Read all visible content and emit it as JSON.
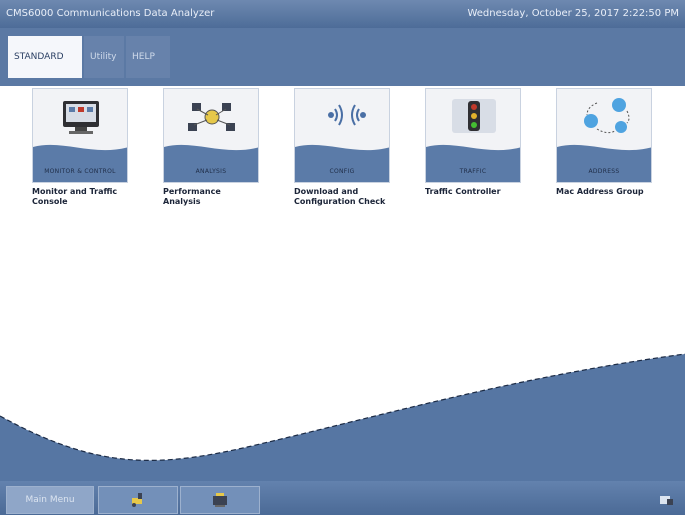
{
  "window": {
    "title": "CMS6000 Communications Data Analyzer",
    "datetime": "Wednesday, October 25, 2017 2:22:50 PM"
  },
  "tabs": [
    {
      "label": "STANDARD",
      "active": true
    },
    {
      "label": "Utility",
      "active": false
    },
    {
      "label": "HELP",
      "active": false
    }
  ],
  "tiles": [
    {
      "icon": "monitor-icon",
      "caption": "MONITOR & CONTROL",
      "label": "Monitor and Traffic\nConsole"
    },
    {
      "icon": "network-icon",
      "caption": "ANALYSIS",
      "label": "Performance Analysis"
    },
    {
      "icon": "wireless-icon",
      "caption": "CONFIG",
      "label": "Download and\nConfiguration Check"
    },
    {
      "icon": "traffic-light-icon",
      "caption": "TRAFFIC",
      "label": "Traffic Controller"
    },
    {
      "icon": "group-icon",
      "caption": "ADDRESS",
      "label": "Mac Address Group"
    }
  ],
  "bottom_bar": {
    "main_menu_label": "Main Menu",
    "button2_icon": "tool-icon",
    "button3_icon": "settings-icon",
    "corner_icon": "info-icon"
  },
  "colors": {
    "titlebar": "#5873a0",
    "accent_blue": "#5b79a4",
    "wave_dark": "#4f6f9b",
    "wave_light": "#c9d6e8"
  }
}
